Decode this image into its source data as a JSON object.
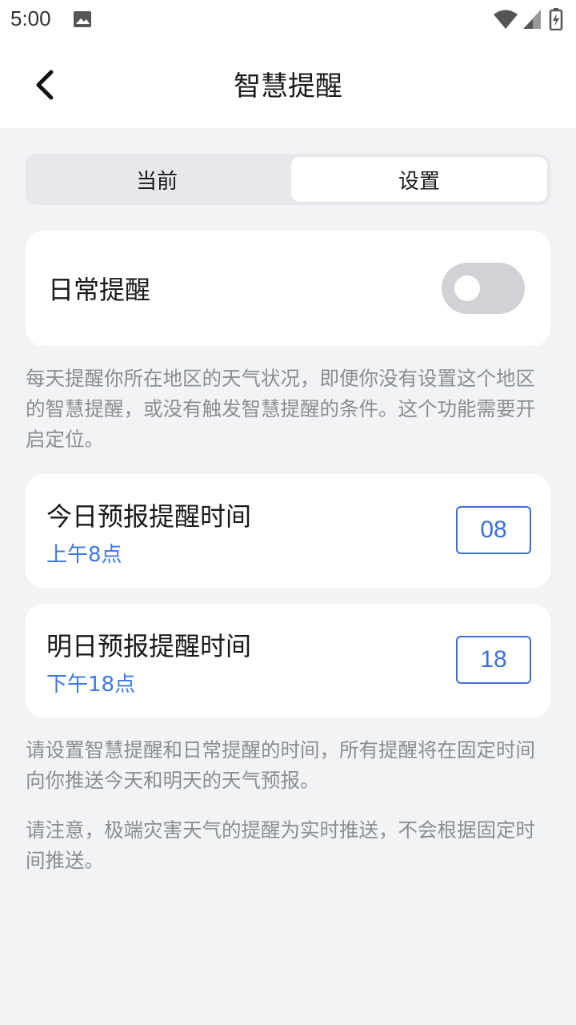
{
  "status_bar": {
    "time": "5:00",
    "icons": [
      "image-icon",
      "wifi-icon",
      "signal-icon",
      "battery-charging-icon"
    ]
  },
  "header": {
    "back_icon": "chevron-left-icon",
    "title": "智慧提醒"
  },
  "tabs": [
    {
      "label": "当前",
      "selected": false
    },
    {
      "label": "设置",
      "selected": true
    }
  ],
  "daily_reminder": {
    "label": "日常提醒",
    "enabled": false
  },
  "daily_description": "每天提醒你所在地区的天气状况，即便你没有设置这个地区的智慧提醒，或没有触发智慧提醒的条件。这个功能需要开启定位。",
  "time_settings": [
    {
      "label": "今日预报提醒时间",
      "sub": "上午8点",
      "value": "08"
    },
    {
      "label": "明日预报提醒时间",
      "sub": "下午18点",
      "value": "18"
    }
  ],
  "notes": [
    "请设置智慧提醒和日常提醒的时间，所有提醒将在固定时间向你推送今天和明天的天气预报。",
    "请注意，极端灾害天气的提醒为实时推送，不会根据固定时间推送。"
  ],
  "colors": {
    "accent": "#3c6fd8",
    "background": "#f2f3f5",
    "toggle_off": "#d0d2d5"
  }
}
